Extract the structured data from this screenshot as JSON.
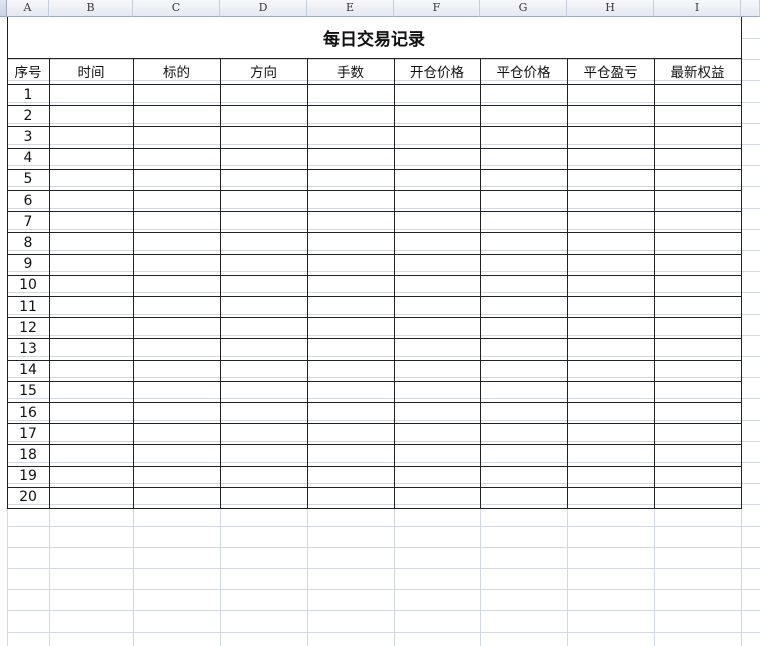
{
  "sheet": {
    "column_letters": [
      "A",
      "B",
      "C",
      "D",
      "E",
      "F",
      "G",
      "H",
      "I"
    ],
    "title": "每日交易记录",
    "headers": [
      "序号",
      "时间",
      "标的",
      "方向",
      "手数",
      "开仓价格",
      "平仓价格",
      "平仓盈亏",
      "最新权益"
    ],
    "row_numbers": [
      "1",
      "2",
      "3",
      "4",
      "5",
      "6",
      "7",
      "8",
      "9",
      "10",
      "11",
      "12",
      "13",
      "14",
      "15",
      "16",
      "17",
      "18",
      "19",
      "20"
    ],
    "colors": {
      "grid": "#d4d9e0",
      "border": "#222222",
      "header_bg": "#e4e9f0"
    }
  }
}
